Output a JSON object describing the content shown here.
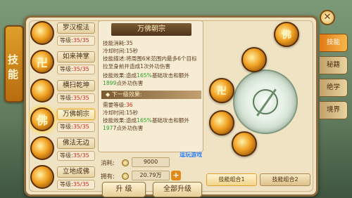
{
  "banner": "技能",
  "skills": [
    {
      "name": "罗汉棍法",
      "level_prefix": "等级:",
      "level": "35/35",
      "icon_glyph": ""
    },
    {
      "name": "如来神掌",
      "level_prefix": "等级:",
      "level": "35/35",
      "icon_glyph": "卍"
    },
    {
      "name": "横扫乾坤",
      "level_prefix": "等级:",
      "level": "35/35",
      "icon_glyph": ""
    },
    {
      "name": "万佛朝宗",
      "level_prefix": "等级:",
      "level": "35/35",
      "icon_glyph": "佛"
    },
    {
      "name": "佛法无边",
      "level_prefix": "等级:",
      "level": "35/35",
      "icon_glyph": ""
    },
    {
      "name": "立地成佛",
      "level_prefix": "等级:",
      "level": "35/35",
      "icon_glyph": ""
    }
  ],
  "detail": {
    "title": "万佛朝宗",
    "consume_label": "技能消耗:",
    "consume_value": "35",
    "cooldown_label": "冷却时间:",
    "cooldown_value": "15秒",
    "desc_label": "技能描述:",
    "desc_text": "将周围6米范围内最多6个目标拉至身前并造成1次外功伤害",
    "effect_label": "技能效果:",
    "effect_text_a": "造成",
    "effect_pct": "165%",
    "effect_text_b": "基础攻击和额外",
    "effect_bonus": "1899",
    "effect_text_c": "点外功伤害",
    "next_header": "下一级效果:",
    "req_label": "需要等级:",
    "req_value": "36",
    "next_cd_label": "冷却时间:",
    "next_cd_value": "15秒",
    "next_effect_label": "技能效果:",
    "next_effect_a": "造成",
    "next_effect_pct": "165%",
    "next_effect_b": "基础攻击和额外",
    "next_effect_bonus": "197",
    "next_effect_c": "7点外功伤害"
  },
  "cost": {
    "consume_label": "消耗:",
    "consume_value": "9000",
    "owned_label": "拥有:",
    "owned_value": "20.79万",
    "plus": "+"
  },
  "buttons": {
    "upgrade": "升 级",
    "upgrade_all": "全部升级"
  },
  "watermark": "逗玩游戏",
  "wheel": {
    "orbs": [
      "佛",
      "",
      "卍",
      "",
      ""
    ],
    "combo1": "技能组合1",
    "combo2": "技能组合2"
  },
  "tabs": [
    "技能",
    "秘籍",
    "绝学",
    "境界"
  ],
  "close_glyph": "✕"
}
